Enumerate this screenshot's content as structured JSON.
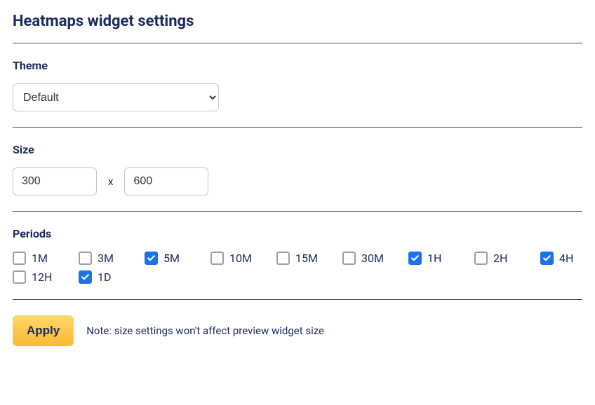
{
  "title": "Heatmaps widget settings",
  "theme": {
    "label": "Theme",
    "value": "Default",
    "options": [
      "Default"
    ]
  },
  "size": {
    "label": "Size",
    "width": "300",
    "height": "600",
    "separator": "x"
  },
  "periods": {
    "label": "Periods",
    "items": [
      {
        "label": "1M",
        "checked": false
      },
      {
        "label": "3M",
        "checked": false
      },
      {
        "label": "5M",
        "checked": true
      },
      {
        "label": "10M",
        "checked": false
      },
      {
        "label": "15M",
        "checked": false
      },
      {
        "label": "30M",
        "checked": false
      },
      {
        "label": "1H",
        "checked": true
      },
      {
        "label": "2H",
        "checked": false
      },
      {
        "label": "4H",
        "checked": true
      },
      {
        "label": "12H",
        "checked": false
      },
      {
        "label": "1D",
        "checked": true
      }
    ]
  },
  "footer": {
    "apply_label": "Apply",
    "note": "Note: size settings won't affect preview widget size"
  }
}
